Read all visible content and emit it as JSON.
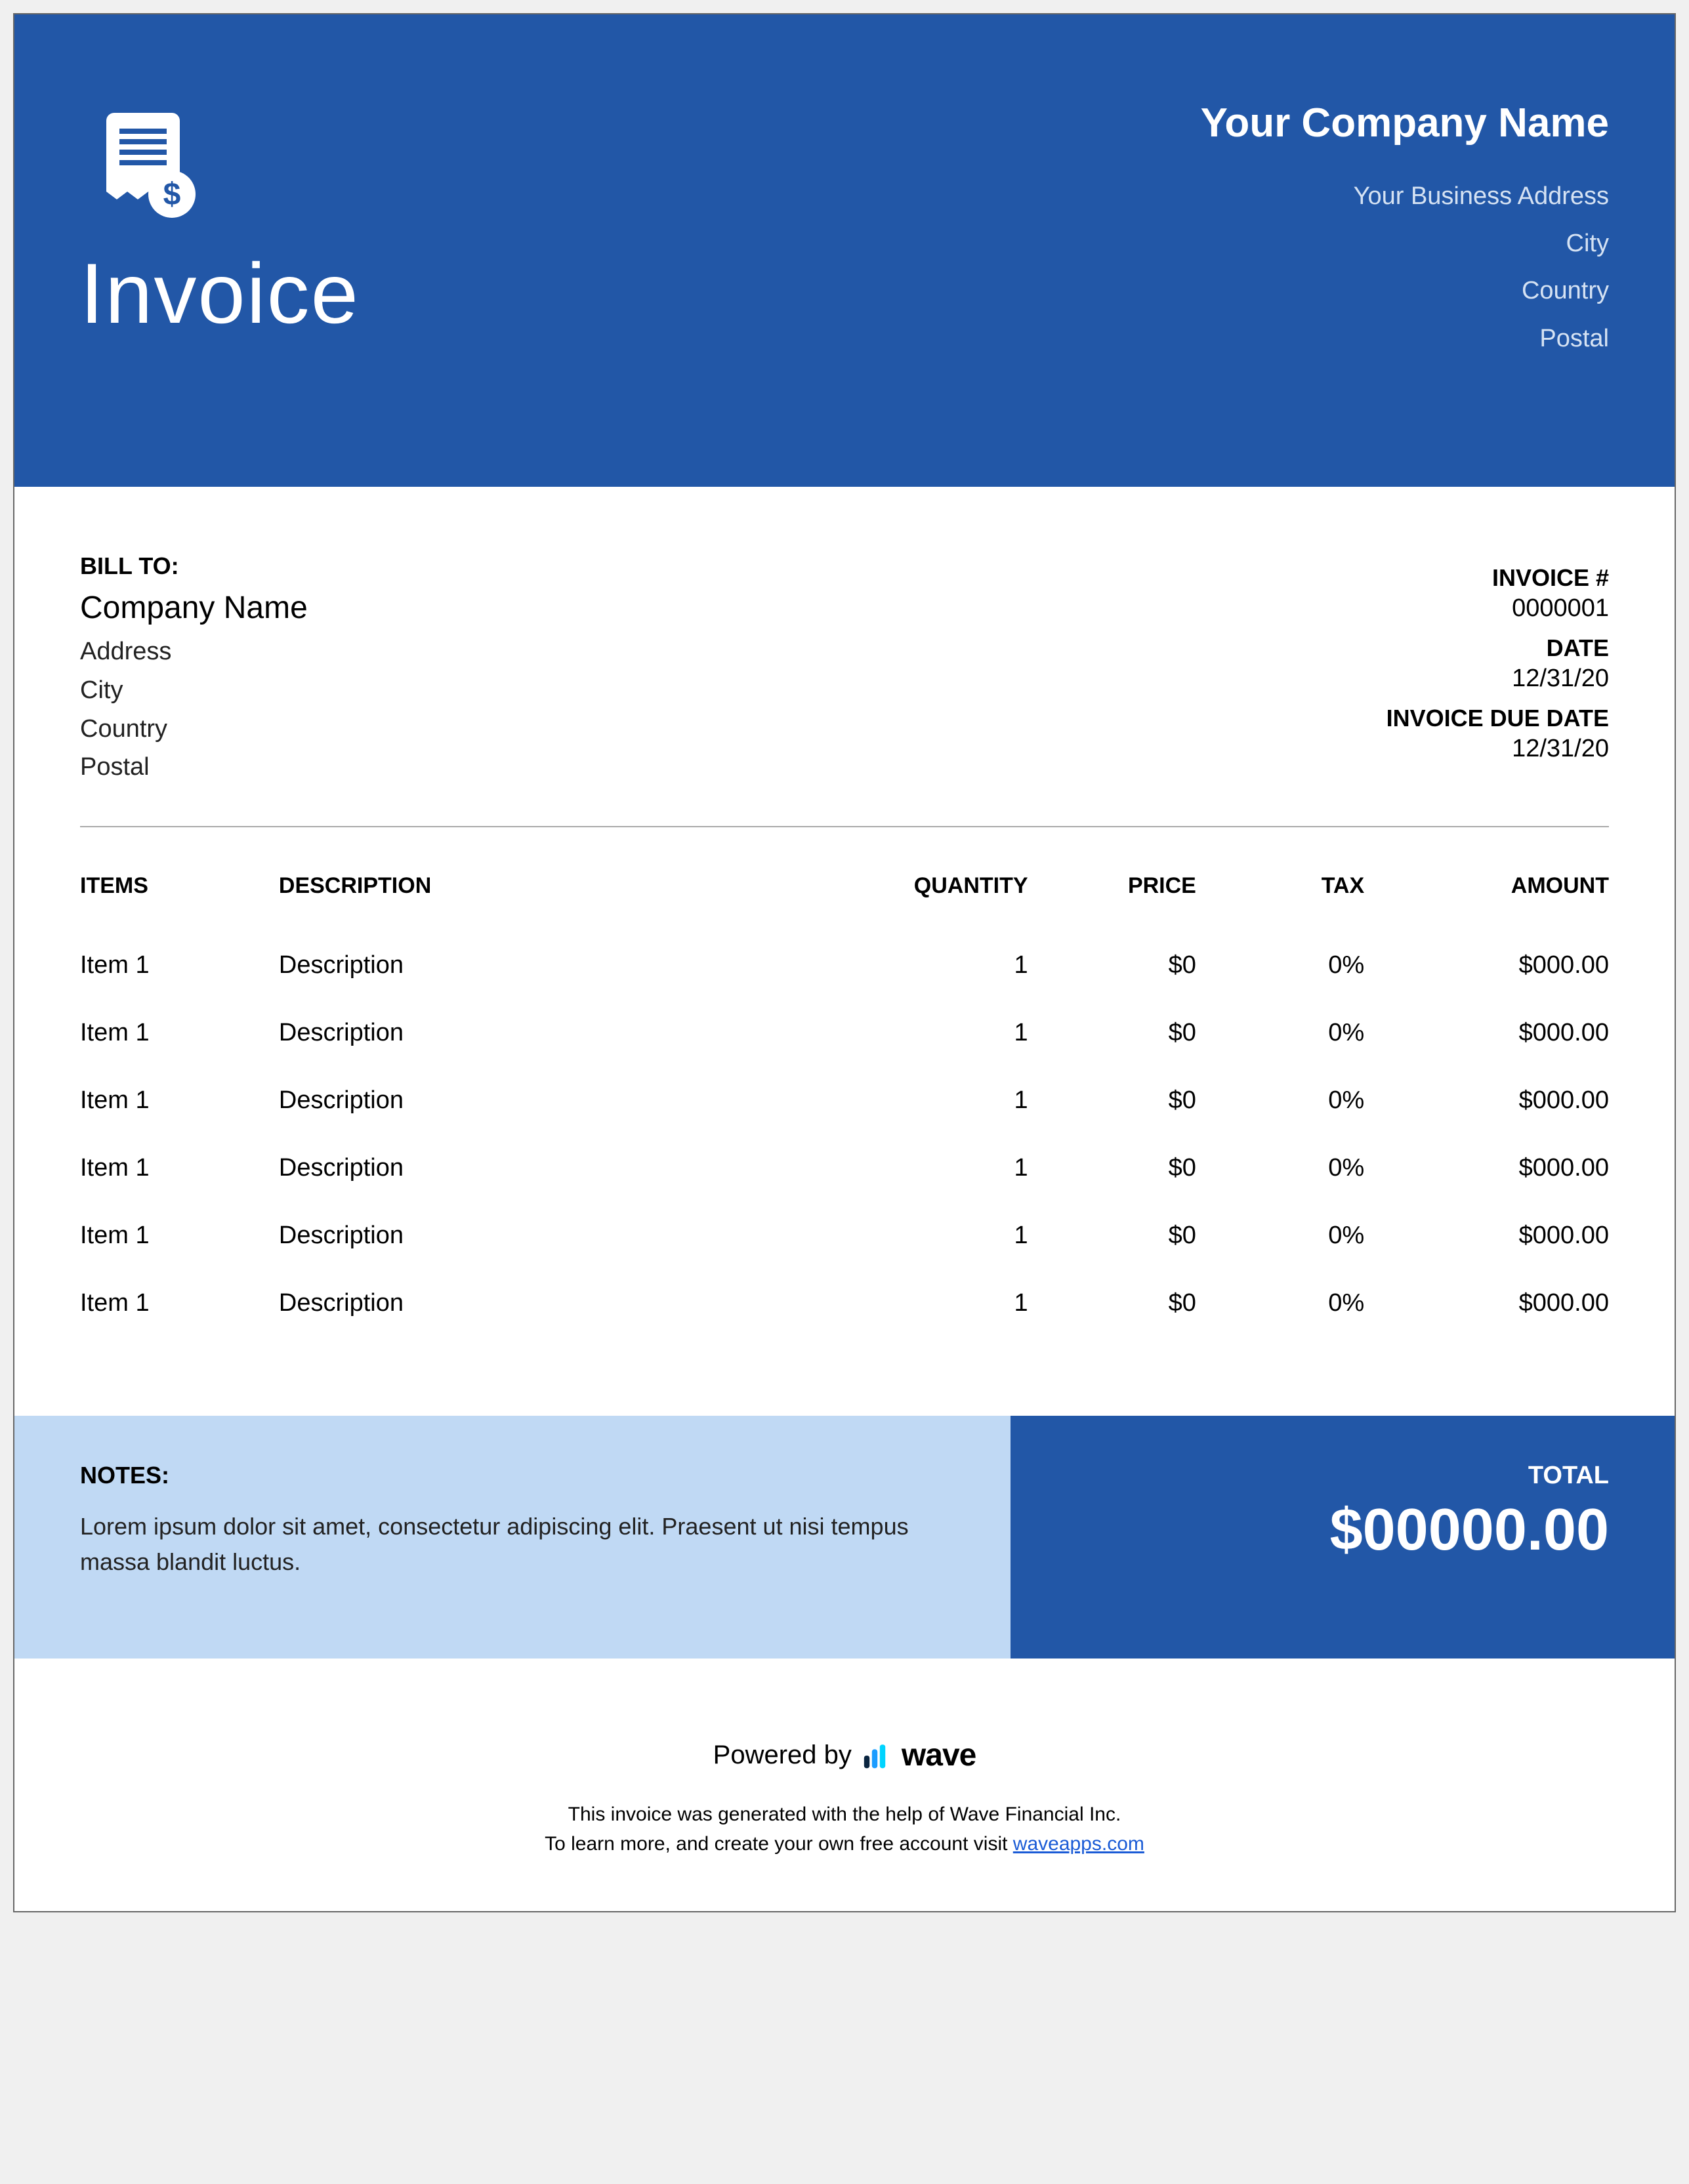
{
  "header": {
    "title": "Invoice",
    "company_name": "Your Company Name",
    "address": "Your Business Address",
    "city": "City",
    "country": "Country",
    "postal": "Postal"
  },
  "bill_to": {
    "label": "BILL TO:",
    "company": "Company Name",
    "address": "Address",
    "city": "City",
    "country": "Country",
    "postal": "Postal"
  },
  "invoice_meta": {
    "number_label": "INVOICE #",
    "number": "0000001",
    "date_label": "DATE",
    "date": "12/31/20",
    "due_label": "INVOICE DUE DATE",
    "due": "12/31/20"
  },
  "columns": {
    "items": "ITEMS",
    "description": "DESCRIPTION",
    "quantity": "QUANTITY",
    "price": "PRICE",
    "tax": "TAX",
    "amount": "AMOUNT"
  },
  "rows": [
    {
      "item": "Item 1",
      "description": "Description",
      "quantity": "1",
      "price": "$0",
      "tax": "0%",
      "amount": "$000.00"
    },
    {
      "item": "Item 1",
      "description": "Description",
      "quantity": "1",
      "price": "$0",
      "tax": "0%",
      "amount": "$000.00"
    },
    {
      "item": "Item 1",
      "description": "Description",
      "quantity": "1",
      "price": "$0",
      "tax": "0%",
      "amount": "$000.00"
    },
    {
      "item": "Item 1",
      "description": "Description",
      "quantity": "1",
      "price": "$0",
      "tax": "0%",
      "amount": "$000.00"
    },
    {
      "item": "Item 1",
      "description": "Description",
      "quantity": "1",
      "price": "$0",
      "tax": "0%",
      "amount": "$000.00"
    },
    {
      "item": "Item 1",
      "description": "Description",
      "quantity": "1",
      "price": "$0",
      "tax": "0%",
      "amount": "$000.00"
    }
  ],
  "notes": {
    "label": "NOTES:",
    "text": "Lorem ipsum dolor sit amet, consectetur adipiscing elit. Praesent ut nisi tempus massa blandit luctus."
  },
  "total": {
    "label": "TOTAL",
    "amount": "$00000.00"
  },
  "footer": {
    "powered_by": "Powered by",
    "brand": "wave",
    "line1": "This invoice was generated with the help of Wave Financial Inc.",
    "line2_prefix": "To learn more, and create your own free account visit ",
    "link": "waveapps.com"
  },
  "colors": {
    "primary": "#2257a7",
    "notes_bg": "#c0d9f4"
  }
}
